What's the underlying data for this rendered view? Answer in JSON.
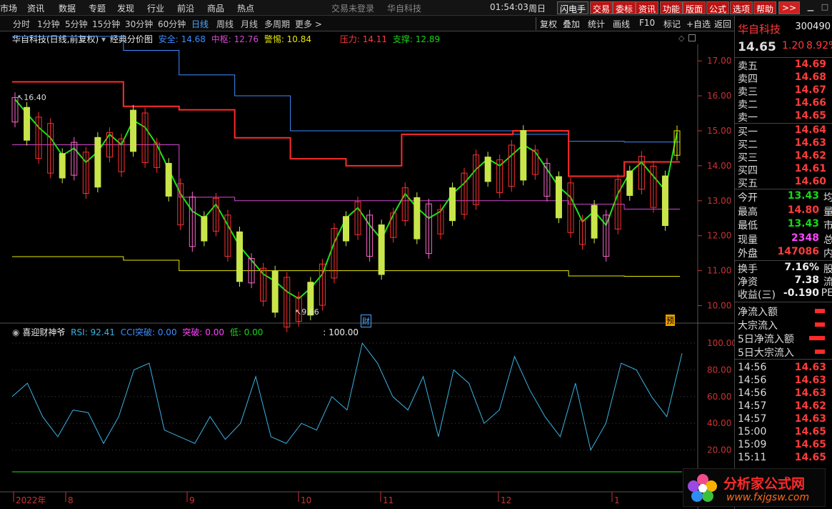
{
  "menubar": {
    "items": [
      "市场",
      "资讯",
      "数据",
      "专题",
      "发现",
      "行业",
      "前沿",
      "商品",
      "热点"
    ],
    "center": [
      "交易未登录",
      "华自科技"
    ],
    "clock": "01:54:03",
    "weekday": "周日",
    "buttons": [
      "闪电手",
      "交易",
      "委标",
      "资讯",
      "功能",
      "版面",
      "公式",
      "选项",
      "帮助"
    ],
    "arrows": ">>"
  },
  "periodbar": {
    "periods": [
      "分时",
      "1分钟",
      "5分钟",
      "15分钟",
      "30分钟",
      "60分钟",
      "日线",
      "周线",
      "月线",
      "多周期",
      "更多 >"
    ],
    "active_index": 6,
    "right_tools": [
      "复权",
      "叠加",
      "统计",
      "画线",
      "F10",
      "标记",
      "+自选",
      "返回"
    ]
  },
  "main_legend": {
    "title": "华自科技(日线,前复权)",
    "formula": "经典分价图",
    "safe": "安全: 14.68",
    "hub": "中枢: 12.76",
    "alert": "警惕: 10.84",
    "pressure": "压力: 14.11",
    "support": "支撑: 12.89"
  },
  "price_axis": [
    "17.00",
    "16.00",
    "15.00",
    "14.00",
    "13.00",
    "12.00",
    "11.00",
    "10.00"
  ],
  "annotations": {
    "high": "16.40",
    "low": "9.66",
    "cai": "财",
    "yu": "预"
  },
  "sub_legend": {
    "name": "喜迎财神爷",
    "rsi": "RSI: 92.41",
    "cci": "CCI突破: 0.00",
    "tupo": "突破: 0.00",
    "di": "低: 0.00",
    "level": ": 100.00"
  },
  "sub_axis": [
    "100.00",
    "80.00",
    "60.00",
    "40.00",
    "20.00"
  ],
  "date_axis": [
    {
      "label": "2022年"
    },
    {
      "label": "8"
    },
    {
      "label": "9"
    },
    {
      "label": "10"
    },
    {
      "label": "11"
    },
    {
      "label": "12"
    },
    {
      "label": "1"
    }
  ],
  "quote": {
    "name": "华自科技",
    "code": "300490",
    "price": "14.65",
    "change": "1.20",
    "pct": "8.92%",
    "asks": [
      {
        "label": "卖五",
        "price": "14.69"
      },
      {
        "label": "卖四",
        "price": "14.68"
      },
      {
        "label": "卖三",
        "price": "14.67"
      },
      {
        "label": "卖二",
        "price": "14.66"
      },
      {
        "label": "卖一",
        "price": "14.65"
      }
    ],
    "bids": [
      {
        "label": "买一",
        "price": "14.64"
      },
      {
        "label": "买二",
        "price": "14.63"
      },
      {
        "label": "买三",
        "price": "14.62"
      },
      {
        "label": "买四",
        "price": "14.61"
      },
      {
        "label": "买五",
        "price": "14.60"
      }
    ],
    "stats": [
      {
        "label": "今开",
        "value": "13.43",
        "color": "green",
        "tail": "均"
      },
      {
        "label": "最高",
        "value": "14.80",
        "color": "red",
        "tail": "量"
      },
      {
        "label": "最低",
        "value": "13.43",
        "color": "green",
        "tail": "市"
      },
      {
        "label": "现量",
        "value": "2348",
        "color": "mag",
        "tail": "总"
      },
      {
        "label": "外盘",
        "value": "147086",
        "color": "red",
        "tail": "内"
      }
    ],
    "stats2": [
      {
        "label": "换手",
        "value": "7.16%",
        "tail": "股"
      },
      {
        "label": "净资",
        "value": "7.38",
        "tail": "流"
      },
      {
        "label": "收益(三)",
        "value": "-0.190",
        "tail": "PE"
      }
    ],
    "flows": [
      "净流入额",
      "大宗流入",
      "5日净流入额",
      "5日大宗流入"
    ],
    "ticks": [
      {
        "time": "14:56",
        "price": "14.63"
      },
      {
        "time": "14:56",
        "price": "14.63"
      },
      {
        "time": "14:56",
        "price": "14.63"
      },
      {
        "time": "14:57",
        "price": "14.62"
      },
      {
        "time": "14:57",
        "price": "14.63"
      },
      {
        "time": "15:00",
        "price": "14.65"
      },
      {
        "time": "15:09",
        "price": "14.65"
      },
      {
        "time": "15:11",
        "price": "14.65"
      }
    ]
  },
  "logo": {
    "text": "分析家公式网",
    "url": "www.fxjgsw.com"
  },
  "colors": {
    "red": "#ff2a2a",
    "green": "#17e617",
    "blue": "#3d8dff",
    "magenta": "#d24ad2",
    "yellow": "#e8e800",
    "cyan": "#3ab4e6"
  },
  "chart_data": {
    "type": "line",
    "title": "经典分价图",
    "ylim": [
      9.5,
      17.8
    ],
    "series": [
      {
        "name": "安全",
        "values": [
          17.7,
          17.7,
          17.3,
          16.6,
          16.0,
          15.0,
          15.0,
          15.0,
          15.0,
          14.9,
          14.7,
          14.68
        ]
      },
      {
        "name": "压力",
        "values": [
          16.4,
          16.4,
          15.7,
          15.6,
          14.8,
          14.2,
          14.0,
          14.9,
          14.9,
          15.0,
          13.7,
          14.11
        ]
      },
      {
        "name": "中枢",
        "values": [
          14.6,
          14.6,
          14.6,
          13.1,
          13.0,
          13.0,
          13.0,
          13.0,
          13.0,
          13.0,
          12.9,
          12.76
        ]
      },
      {
        "name": "警惕",
        "values": [
          11.4,
          11.4,
          11.3,
          11.0,
          11.0,
          11.0,
          11.0,
          11.0,
          11.0,
          11.0,
          10.85,
          10.84
        ]
      }
    ],
    "sub_chart": {
      "type": "line",
      "ylim": [
        0,
        100
      ],
      "rsi": [
        60,
        70,
        45,
        30,
        50,
        48,
        25,
        45,
        80,
        85,
        35,
        30,
        25,
        45,
        28,
        40,
        75,
        30,
        25,
        40,
        35,
        60,
        50,
        100,
        85,
        60,
        50,
        75,
        30,
        80,
        70,
        40,
        50,
        90,
        65,
        45,
        30,
        70,
        20,
        40,
        85,
        80,
        60,
        45,
        92.41
      ]
    }
  }
}
